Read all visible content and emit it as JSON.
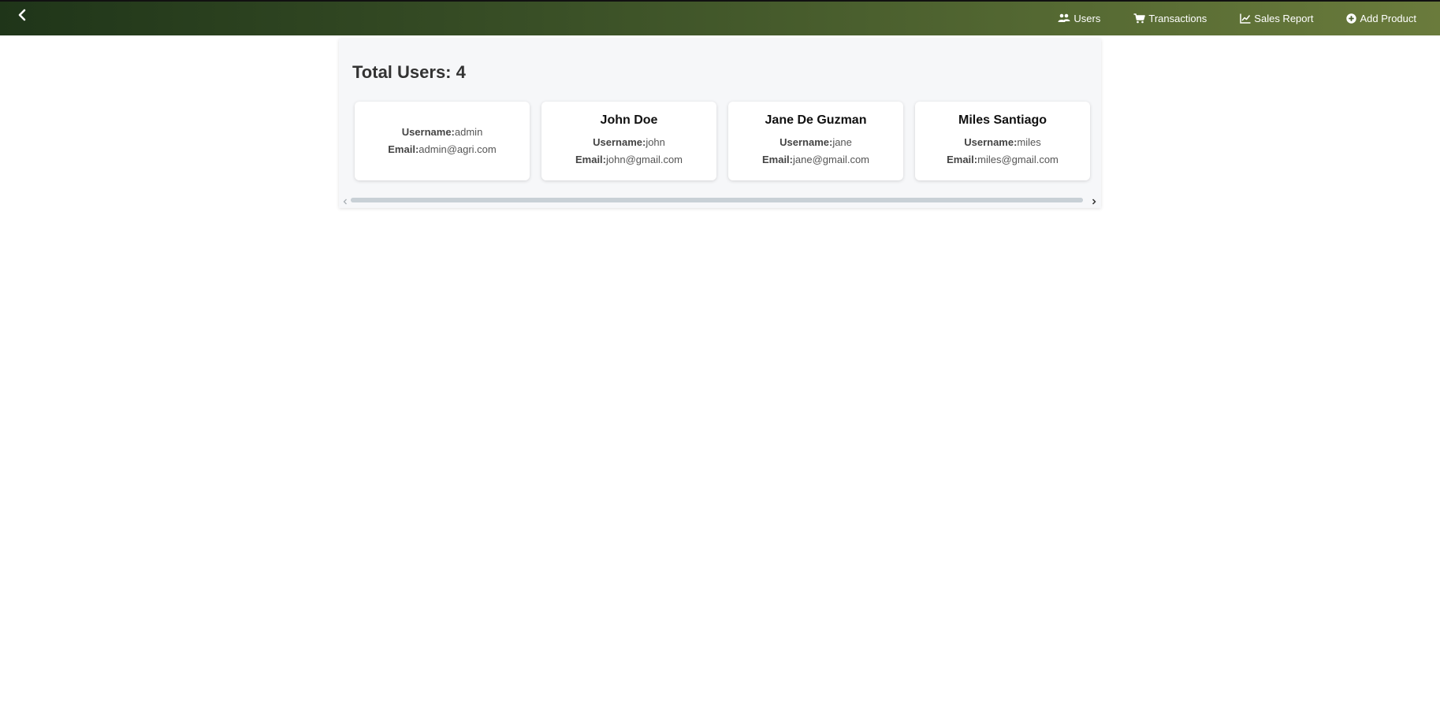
{
  "topbar": {
    "back_icon": "chevron-left-icon",
    "nav": [
      {
        "label": "Users",
        "icon": "users-icon"
      },
      {
        "label": "Transactions",
        "icon": "cart-icon"
      },
      {
        "label": "Sales Report",
        "icon": "line-chart-icon"
      },
      {
        "label": "Add Product",
        "icon": "plus-circle-icon"
      }
    ]
  },
  "users_panel": {
    "title": "Total Users: 4",
    "username_label": "Username:",
    "email_label": "Email:",
    "cards": [
      {
        "name": "",
        "username": "admin",
        "email": "admin@agri.com"
      },
      {
        "name": "John Doe",
        "username": "john",
        "email": "john@gmail.com"
      },
      {
        "name": "Jane De Guzman",
        "username": "jane",
        "email": "jane@gmail.com"
      },
      {
        "name": "Miles Santiago",
        "username": "miles",
        "email": "miles@gmail.com"
      }
    ],
    "scroll_fraction": 1.0
  }
}
